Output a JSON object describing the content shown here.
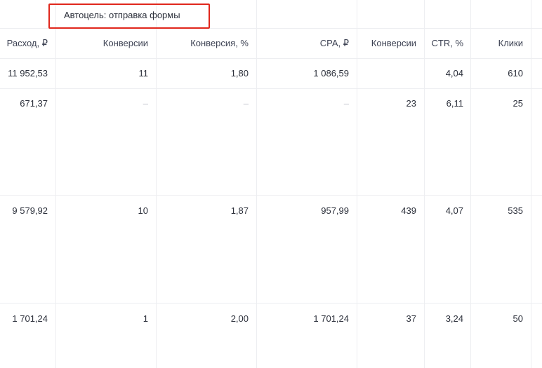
{
  "group_header": {
    "label": "Автоцель: отправка формы"
  },
  "columns": [
    {
      "key": "spend",
      "label": "Расход, ₽"
    },
    {
      "key": "conversions",
      "label": "Конверсии"
    },
    {
      "key": "conversion_rate",
      "label": "Конверсия, %"
    },
    {
      "key": "cpa",
      "label": "CPA, ₽"
    },
    {
      "key": "conversions_total",
      "label": "Конверсии"
    },
    {
      "key": "ctr",
      "label": "CTR, %"
    },
    {
      "key": "clicks",
      "label": "Клики"
    }
  ],
  "rows": [
    {
      "spend": "11 952,53",
      "conversions": "11",
      "conversion_rate": "1,80",
      "cpa": "1 086,59",
      "conversions_total": "",
      "ctr": "4,04",
      "clicks": "610"
    },
    {
      "spend": "671,37",
      "conversions": "–",
      "conversion_rate": "–",
      "cpa": "–",
      "conversions_total": "23",
      "ctr": "6,11",
      "clicks": "25"
    },
    {
      "spend": "9 579,92",
      "conversions": "10",
      "conversion_rate": "1,87",
      "cpa": "957,99",
      "conversions_total": "439",
      "ctr": "4,07",
      "clicks": "535"
    },
    {
      "spend": "1 701,24",
      "conversions": "1",
      "conversion_rate": "2,00",
      "cpa": "1 701,24",
      "conversions_total": "37",
      "ctr": "3,24",
      "clicks": "50"
    }
  ]
}
